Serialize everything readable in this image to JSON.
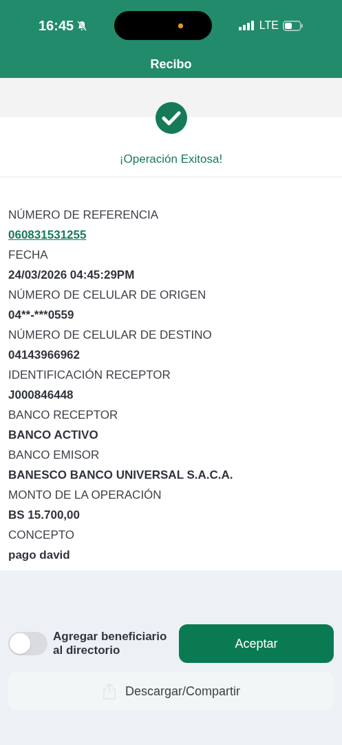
{
  "status_bar": {
    "time": "16:45",
    "network": "LTE"
  },
  "header": {
    "title": "Recibo"
  },
  "result": {
    "message": "¡Operación Exitosa!"
  },
  "details": [
    {
      "label": "NÚMERO DE REFERENCIA",
      "value": "060831531255",
      "kind": "link"
    },
    {
      "label": "FECHA",
      "value": "24/03/2026 04:45:29PM",
      "kind": "text"
    },
    {
      "label": "NÚMERO DE CELULAR DE ORIGEN",
      "value": "04**-***0559",
      "kind": "text"
    },
    {
      "label": "NÚMERO DE CELULAR DE DESTINO",
      "value": "04143966962",
      "kind": "text"
    },
    {
      "label": "IDENTIFICACIÓN RECEPTOR",
      "value": "J000846448",
      "kind": "text"
    },
    {
      "label": "BANCO RECEPTOR",
      "value": "BANCO ACTIVO",
      "kind": "text"
    },
    {
      "label": "BANCO EMISOR",
      "value": "BANESCO BANCO UNIVERSAL S.A.C.A.",
      "kind": "text"
    },
    {
      "label": "MONTO DE LA OPERACIÓN",
      "value": "BS 15.700,00",
      "kind": "text"
    },
    {
      "label": "CONCEPTO",
      "value": "pago david",
      "kind": "text"
    }
  ],
  "add_beneficiary": {
    "label": "Agregar beneficiario al directorio",
    "on": false
  },
  "buttons": {
    "accept": "Aceptar",
    "share": "Descargar/Compartir"
  }
}
